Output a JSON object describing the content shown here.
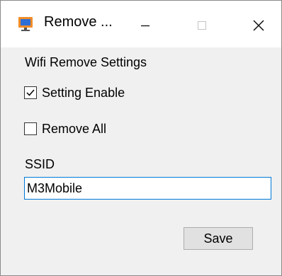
{
  "window": {
    "title": "Remove ...",
    "app_icon": "monitor-app-icon",
    "controls": {
      "minimize_icon": "minimize-icon",
      "maximize_icon": "maximize-icon",
      "close_icon": "close-icon"
    }
  },
  "settings": {
    "group_label": "Wifi Remove Settings",
    "setting_enable": {
      "label": "Setting Enable",
      "checked": true
    },
    "remove_all": {
      "label": "Remove All",
      "checked": false
    },
    "ssid": {
      "label": "SSID",
      "value": "M3Mobile"
    },
    "save_label": "Save"
  },
  "colors": {
    "focus_border": "#0078d7",
    "button_bg": "#e1e1e1",
    "window_bg": "#f0f0f0"
  }
}
